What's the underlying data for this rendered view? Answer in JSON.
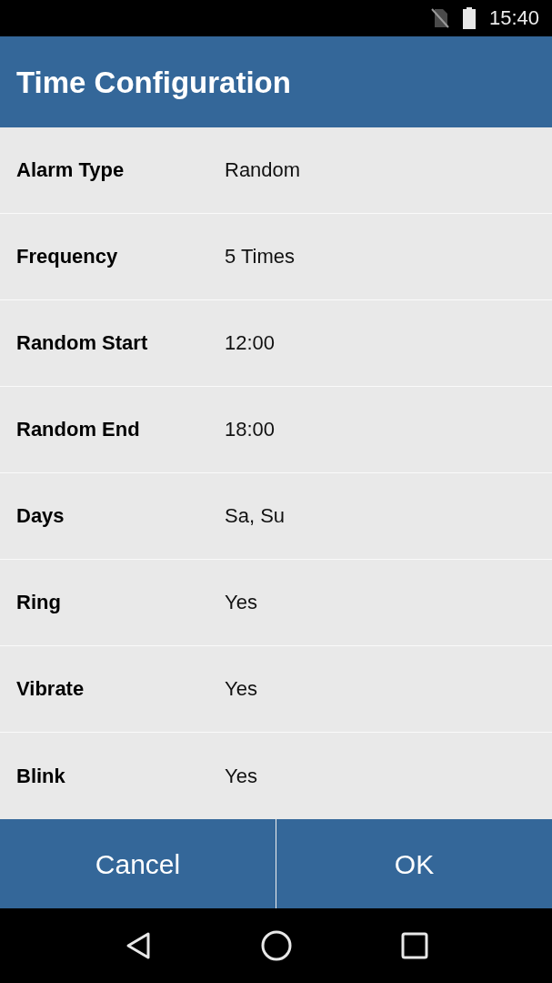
{
  "status_bar": {
    "time": "15:40"
  },
  "header": {
    "title": "Time Configuration"
  },
  "settings": [
    {
      "label": "Alarm Type",
      "value": "Random"
    },
    {
      "label": "Frequency",
      "value": "5 Times"
    },
    {
      "label": "Random Start",
      "value": "12:00"
    },
    {
      "label": "Random End",
      "value": "18:00"
    },
    {
      "label": "Days",
      "value": "Sa, Su"
    },
    {
      "label": "Ring",
      "value": "Yes"
    },
    {
      "label": "Vibrate",
      "value": "Yes"
    },
    {
      "label": "Blink",
      "value": "Yes"
    }
  ],
  "buttons": [
    {
      "label": "Cancel"
    },
    {
      "label": "OK"
    }
  ]
}
